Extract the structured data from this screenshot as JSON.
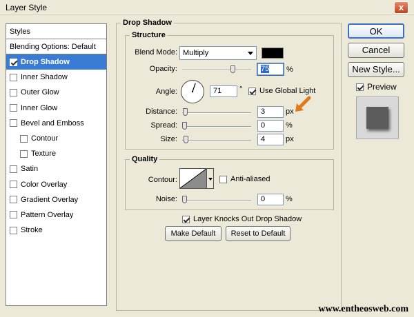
{
  "window": {
    "title": "Layer Style",
    "close_glyph": "x"
  },
  "styles": {
    "header": "Styles",
    "blending_options": "Blending Options: Default",
    "items": [
      {
        "label": "Drop Shadow",
        "checked": true,
        "selected": true,
        "sub": false
      },
      {
        "label": "Inner Shadow",
        "checked": false,
        "selected": false,
        "sub": false
      },
      {
        "label": "Outer Glow",
        "checked": false,
        "selected": false,
        "sub": false
      },
      {
        "label": "Inner Glow",
        "checked": false,
        "selected": false,
        "sub": false
      },
      {
        "label": "Bevel and Emboss",
        "checked": false,
        "selected": false,
        "sub": false
      },
      {
        "label": "Contour",
        "checked": false,
        "selected": false,
        "sub": true
      },
      {
        "label": "Texture",
        "checked": false,
        "selected": false,
        "sub": true
      },
      {
        "label": "Satin",
        "checked": false,
        "selected": false,
        "sub": false
      },
      {
        "label": "Color Overlay",
        "checked": false,
        "selected": false,
        "sub": false
      },
      {
        "label": "Gradient Overlay",
        "checked": false,
        "selected": false,
        "sub": false
      },
      {
        "label": "Pattern Overlay",
        "checked": false,
        "selected": false,
        "sub": false
      },
      {
        "label": "Stroke",
        "checked": false,
        "selected": false,
        "sub": false
      }
    ]
  },
  "panel": {
    "title": "Drop Shadow",
    "structure": {
      "title": "Structure",
      "blend_mode_label": "Blend Mode:",
      "blend_mode_value": "Multiply",
      "shadow_color": "#000000",
      "opacity_label": "Opacity:",
      "opacity_value": "75",
      "opacity_unit": "%",
      "opacity_fraction": 0.75,
      "angle_label": "Angle:",
      "angle_value": "71",
      "angle_unit": "°",
      "angle_degrees": 71,
      "global_light_label": "Use Global Light",
      "global_light_checked": true,
      "distance_label": "Distance:",
      "distance_value": "3",
      "distance_unit": "px",
      "distance_fraction": 0.01,
      "spread_label": "Spread:",
      "spread_value": "0",
      "spread_unit": "%",
      "spread_fraction": 0.0,
      "size_label": "Size:",
      "size_value": "4",
      "size_unit": "px",
      "size_fraction": 0.02
    },
    "quality": {
      "title": "Quality",
      "contour_label": "Contour:",
      "anti_aliased_label": "Anti-aliased",
      "anti_aliased_checked": false,
      "noise_label": "Noise:",
      "noise_value": "0",
      "noise_unit": "%",
      "noise_fraction": 0.0
    },
    "knockout_label": "Layer Knocks Out Drop Shadow",
    "knockout_checked": true,
    "make_default_label": "Make Default",
    "reset_default_label": "Reset to Default"
  },
  "buttons": {
    "ok": "OK",
    "cancel": "Cancel",
    "new_style": "New Style..."
  },
  "preview": {
    "label": "Preview",
    "checked": true
  },
  "watermark": "www.entheosweb.com",
  "colors": {
    "selection": "#3a7bd5",
    "annotation_arrow": "#e07a1a"
  }
}
